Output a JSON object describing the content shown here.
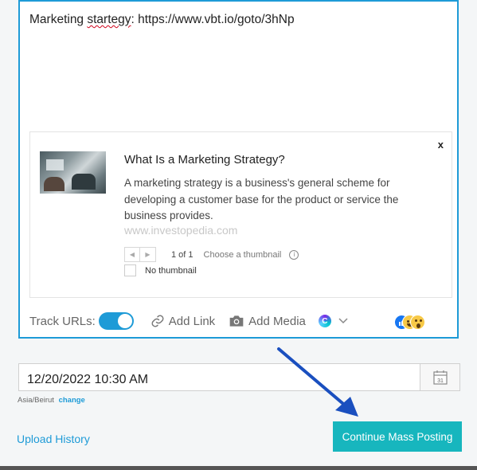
{
  "post": {
    "text_prefix": "Marketing ",
    "text_misspelled": "startegy",
    "text_suffix": ": https://www.vbt.io/goto/3hNp"
  },
  "preview": {
    "close_label": "x",
    "title": "What Is a Marketing Strategy?",
    "description": "A marketing strategy is a business's general scheme for developing a customer base for the product or service the business provides.",
    "domain": "www.investopedia.com",
    "pager_prev": "◀",
    "pager_next": "▶",
    "pager_count": "1 of 1",
    "choose_label": "Choose a thumbnail",
    "info_glyph": "i",
    "no_thumbnail_label": "No thumbnail"
  },
  "toolbar": {
    "track_urls_label": "Track URLs:",
    "track_urls_enabled": true,
    "add_link_label": "Add Link",
    "add_media_label": "Add Media",
    "canva_glyph": "C"
  },
  "schedule": {
    "datetime_value": "12/20/2022 10:30 AM",
    "calendar_day": "31",
    "timezone": "Asia/Beirut",
    "change_label": "change"
  },
  "footer": {
    "upload_history_label": "Upload History",
    "continue_label": "Continue Mass Posting"
  },
  "colors": {
    "accent": "#1e9bd7",
    "button": "#17b6be",
    "annotation_arrow": "#1a4fbf"
  }
}
